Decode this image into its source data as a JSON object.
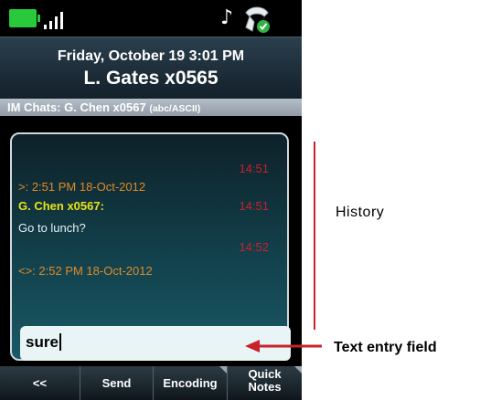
{
  "status_bar": {
    "battery_color": "#28c93a",
    "icons": [
      "battery-icon",
      "signal-icon",
      "music-note-icon",
      "handset-icon"
    ]
  },
  "header": {
    "date_time": "Friday, October 19 3:01 PM",
    "caller": "L. Gates x0565"
  },
  "chat": {
    "title": "IM Chats: G. Chen x0567",
    "encoding": "(abc/ASCII)",
    "timestamps": [
      "14:51",
      "14:51",
      "14:52"
    ],
    "messages": [
      {
        "text": ">: 2:51 PM  18-Oct-2012"
      },
      {
        "text": "G. Chen x0567:"
      },
      {
        "text": "Go to lunch?"
      },
      {
        "text": "<>: 2:52 PM  18-Oct-2012"
      }
    ],
    "entry_value": "sure"
  },
  "softkeys": [
    {
      "label": "<<"
    },
    {
      "label": "Send"
    },
    {
      "label": "Encoding"
    },
    {
      "label_line1": "Quick",
      "label_line2": "Notes"
    }
  ],
  "annotations": {
    "history": "History",
    "text_entry": "Text entry field"
  },
  "colors": {
    "timestamp": "#c8222a",
    "system_text": "#e28a25",
    "sender": "#e9e318"
  }
}
